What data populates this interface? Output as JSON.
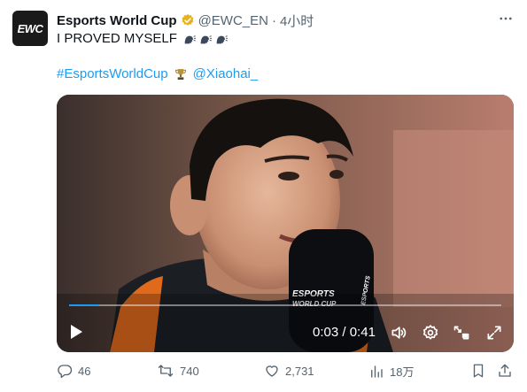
{
  "account": {
    "avatar_text": "EWC",
    "name": "Esports World Cup",
    "handle": "@EWC_EN",
    "separator": "·",
    "time": "4小时",
    "verified_color": "#e8b21c"
  },
  "tweet": {
    "text": "I PROVED MYSELF",
    "emoji_icons": [
      "speaking-head-icon",
      "speaking-head-icon",
      "speaking-head-icon"
    ],
    "hashtag": "#EsportsWorldCup",
    "mention": "@Xiaohai_",
    "link_color": "#1d9bf0"
  },
  "video": {
    "microphone_brand": [
      "ESPORTS",
      "WORLD CUP"
    ],
    "time_current": "0:03",
    "time_separator": " / ",
    "time_total": "0:41",
    "progress": 0.07
  },
  "actions": {
    "replies": "46",
    "reposts": "740",
    "likes": "2,731",
    "views": "18万"
  }
}
